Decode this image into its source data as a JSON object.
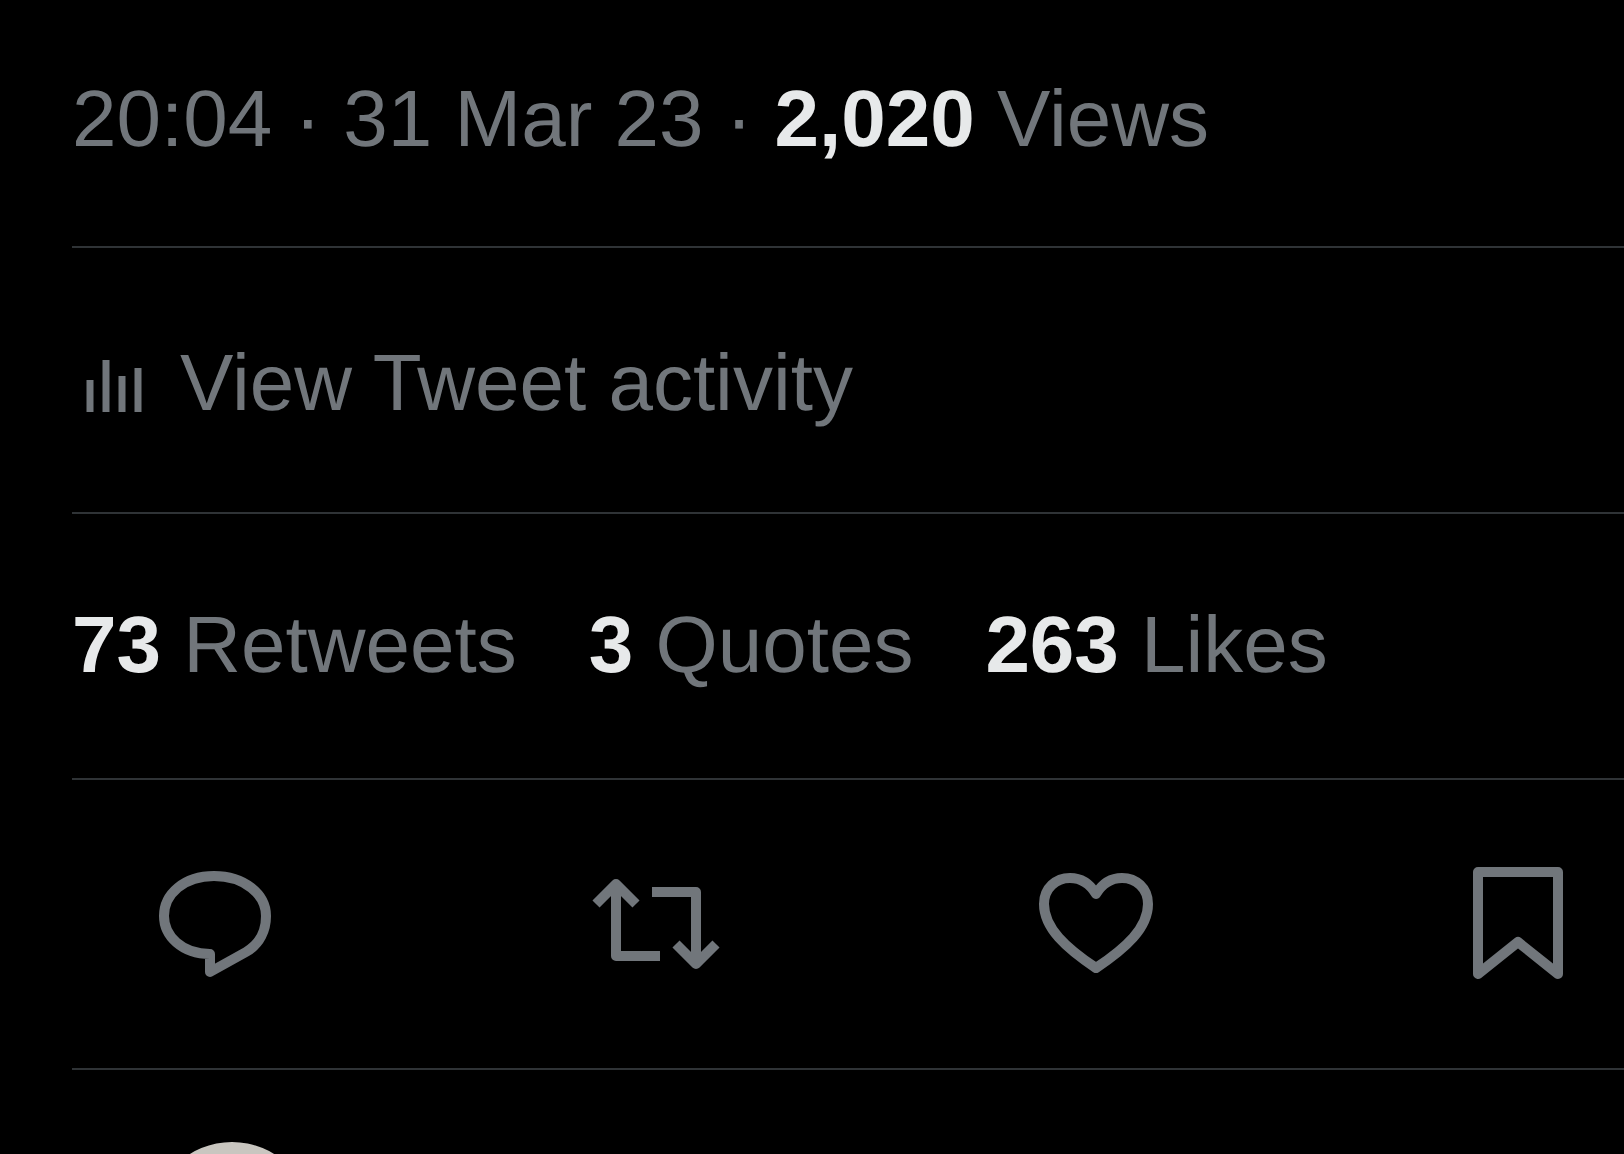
{
  "meta": {
    "text": "20:04 · 31 Mar 23 · **2,020** Views"
  },
  "activity": {
    "label": "View Tweet activity"
  },
  "stats": [
    {
      "count": "73",
      "label": "Retweets"
    },
    {
      "count": "3",
      "label": "Quotes"
    },
    {
      "count": "263",
      "label": "Likes"
    }
  ]
}
